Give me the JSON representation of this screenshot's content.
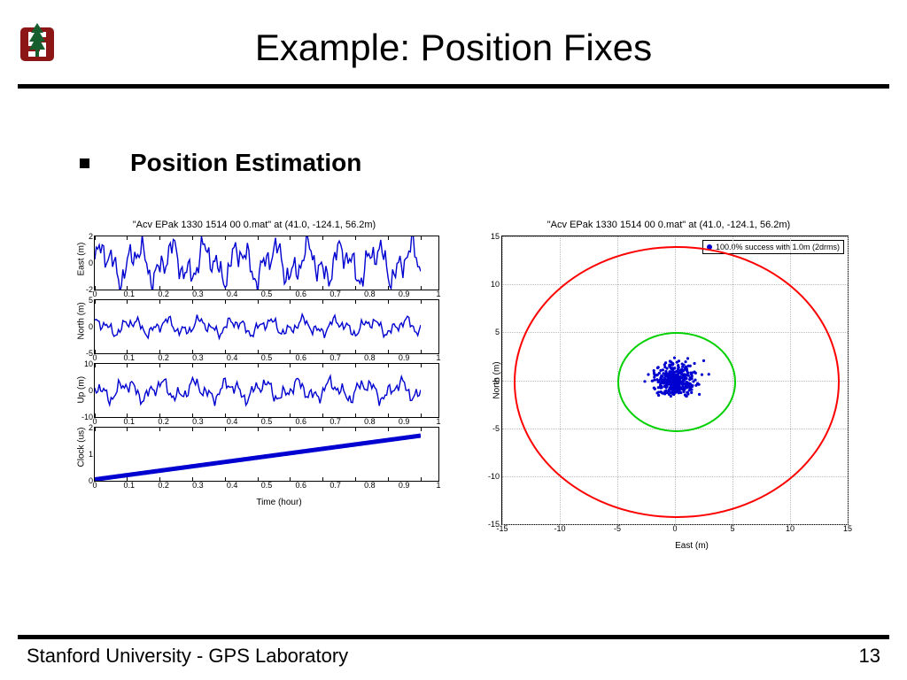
{
  "title": "Example: Position Fixes",
  "bullet": "Position Estimation",
  "footer": {
    "left": "Stanford University - GPS Laboratory",
    "right": "13"
  },
  "chart_data": [
    {
      "type": "line",
      "title": "\"Acv EPak 1330 1514 00 0.mat\" at (41.0, -124.1, 56.2m)",
      "xlabel": "Time (hour)",
      "xlim": [
        0,
        1
      ],
      "xticks": [
        0,
        0.1,
        0.2,
        0.3,
        0.4,
        0.5,
        0.6,
        0.7,
        0.8,
        0.9,
        1
      ],
      "subplots": [
        {
          "ylabel": "East (m)",
          "ylim": [
            -2,
            2
          ],
          "yticks": [
            -2,
            0,
            2
          ],
          "kind": "noise",
          "approx_mean": 0,
          "approx_range": 2
        },
        {
          "ylabel": "North (m)",
          "ylim": [
            -5,
            5
          ],
          "yticks": [
            -5,
            0,
            5
          ],
          "kind": "noise",
          "approx_mean": 0,
          "approx_range": 2
        },
        {
          "ylabel": "Up (m)",
          "ylim": [
            -10,
            10
          ],
          "yticks": [
            -10,
            0,
            10
          ],
          "kind": "noise",
          "approx_mean": 0,
          "approx_range": 5
        },
        {
          "ylabel": "Clock (us)",
          "ylim": [
            0,
            2
          ],
          "yticks": [
            0,
            1,
            2
          ],
          "kind": "linear",
          "start": 0.05,
          "end": 1.7
        }
      ]
    },
    {
      "type": "scatter",
      "title": "\"Acv EPak 1330 1514 00 0.mat\" at (41.0, -124.1, 56.2m)",
      "xlabel": "East (m)",
      "ylabel": "North (m)",
      "xlim": [
        -15,
        15
      ],
      "xticks": [
        -15,
        -10,
        -5,
        0,
        5,
        10,
        15
      ],
      "ylim": [
        -15,
        15
      ],
      "yticks": [
        -15,
        -10,
        -5,
        0,
        5,
        10,
        15
      ],
      "legend": "100.0% success with 1.0m (2drms)",
      "cluster_center": [
        0,
        0
      ],
      "cluster_spread": 1.7,
      "circles": [
        {
          "color": "green",
          "radius": 5
        },
        {
          "color": "red",
          "radius": 14
        }
      ]
    }
  ]
}
